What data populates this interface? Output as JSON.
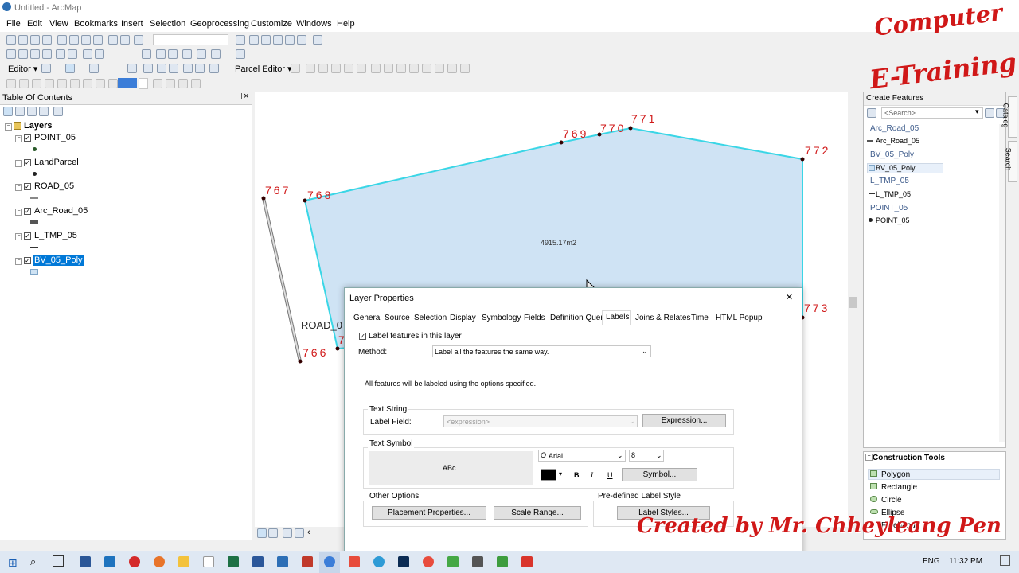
{
  "window": {
    "title": "Untitled - ArcMap"
  },
  "menu": [
    "File",
    "Edit",
    "View",
    "Bookmarks",
    "Insert",
    "Selection",
    "Geoprocessing",
    "Customize",
    "Windows",
    "Help"
  ],
  "toolbar": {
    "editor_label": "Editor ▾",
    "parcel_editor_label": "Parcel Editor ▾"
  },
  "toc": {
    "title": "Table Of Contents",
    "root": "Layers",
    "layers": [
      "POINT_05",
      "LandParcel",
      "ROAD_05",
      "Arc_Road_05",
      "L_TMP_05",
      "BV_05_Poly"
    ]
  },
  "map": {
    "area_label": "4915.17m2",
    "road_label": "ROAD_0",
    "vertex_labels": {
      "v766": "766",
      "v767": "767",
      "v768": "768",
      "v769": "769",
      "v770": "770",
      "v771": "771",
      "v772": "772",
      "v773": "773",
      "v7x": "7"
    }
  },
  "create_features": {
    "title": "Create Features",
    "search_placeholder": "<Search>",
    "groups": [
      {
        "name": "Arc_Road_05",
        "item": "Arc_Road_05"
      },
      {
        "name": "BV_05_Poly",
        "item": "BV_05_Poly"
      },
      {
        "name": "L_TMP_05",
        "item": "L_TMP_05"
      },
      {
        "name": "POINT_05",
        "item": "POINT_05"
      }
    ]
  },
  "construction_tools": {
    "title": "Construction Tools",
    "items": [
      "Polygon",
      "Rectangle",
      "Circle",
      "Ellipse",
      "Freehand"
    ]
  },
  "side_tabs": {
    "catalog": "Catalog",
    "search": "Search"
  },
  "dialog": {
    "title": "Layer Properties",
    "tabs": [
      "General",
      "Source",
      "Selection",
      "Display",
      "Symbology",
      "Fields",
      "Definition Query",
      "Labels",
      "Joins & Relates",
      "Time",
      "HTML Popup"
    ],
    "active_tab": "Labels",
    "label_checkbox": "Label features in this layer",
    "method_label": "Method:",
    "method_value": "Label all the features the same way.",
    "info_text": "All features will be labeled using the options specified.",
    "text_string_title": "Text String",
    "label_field_label": "Label Field:",
    "label_field_value": "<expression>",
    "expression_button": "Expression...",
    "text_symbol_title": "Text Symbol",
    "preview_text": "ABc",
    "font_name": "Arial",
    "font_size": "8",
    "bold": "B",
    "italic": "I",
    "underline": "U",
    "symbol_button": "Symbol...",
    "other_options_title": "Other Options",
    "placement_button": "Placement Properties...",
    "scale_button": "Scale Range...",
    "predefined_title": "Pre-defined Label Style",
    "label_styles_button": "Label Styles..."
  },
  "watermark": {
    "line1": "Computer",
    "line2": "E-Training",
    "credit": "Created by Mr. Chheyleang Pen"
  },
  "taskbar": {
    "lang": "ENG",
    "time": "11:32 PM"
  },
  "colors": {
    "polygon_fill": "#cfe3f4",
    "polygon_edge": "#3ad6e6",
    "label_red": "#d01818"
  }
}
